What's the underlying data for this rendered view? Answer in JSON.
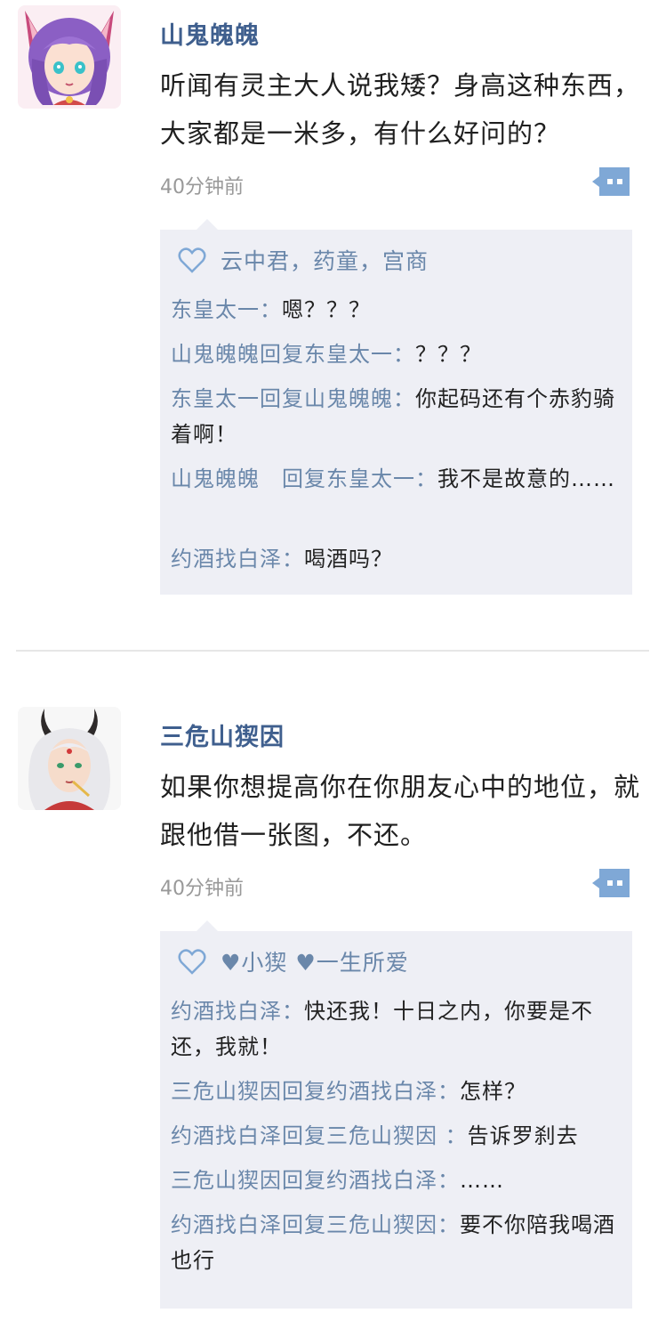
{
  "posts": [
    {
      "author": "山鬼魄魄",
      "content": "听闻有灵主大人说我矮？身高这种东西，大家都是一米多，有什么好问的？",
      "time": "40分钟前",
      "likes": "云中君，药童，宫商",
      "replies": [
        {
          "who": "东皇太一：",
          "text": "嗯？？？"
        },
        {
          "who": "山鬼魄魄回复东皇太一：",
          "text": "？？？"
        },
        {
          "who": "东皇太一回复山鬼魄魄：",
          "text": "你起码还有个赤豹骑着啊！"
        },
        {
          "who": "山鬼魄魄　回复东皇太一：",
          "text": "我不是故意的……"
        },
        {
          "who": "约酒找白泽：",
          "text": "喝酒吗？"
        }
      ]
    },
    {
      "author": "三危山猰因",
      "content": "如果你想提高你在你朋友心中的地位，就跟他借一张图，不还。",
      "time": "40分钟前",
      "likes": "♥小猰 ♥一生所爱",
      "replies": [
        {
          "who": "约酒找白泽：",
          "text": "快还我！十日之内，你要是不还，我就！"
        },
        {
          "who": "三危山猰因回复约酒找白泽：",
          "text": "怎样？"
        },
        {
          "who": "约酒找白泽回复三危山猰因 ：",
          "text": "告诉罗刹去"
        },
        {
          "who": "三危山猰因回复约酒找白泽：",
          "text": "……"
        },
        {
          "who": "约酒找白泽回复三危山猰因：",
          "text": "要不你陪我喝酒也行"
        }
      ]
    }
  ],
  "icons": {
    "comment": "comment-bubble-icon",
    "heart": "heart-outline-icon"
  },
  "colors": {
    "name_blue": "#3f5f8e",
    "reply_name": "#6a87aa",
    "reply_bg": "#eeeff5",
    "comment_icon": "#7fa8d6"
  }
}
